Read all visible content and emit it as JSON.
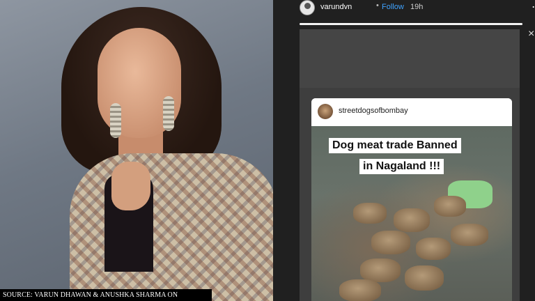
{
  "left_panel": {
    "caption": "SOURCE: VARUN DHAWAN & ANUSHKA SHARMA ON INSTAGRAM"
  },
  "story": {
    "username": "varundvn",
    "separator": "•",
    "follow_label": "Follow",
    "time": "19h",
    "more_icon": "⋯",
    "close_icon": "×",
    "progress": 1.0,
    "shared_post": {
      "username": "streetdogsofbombay",
      "overlay_line_1": "Dog meat trade Banned",
      "overlay_line_2": "in Nagaland !!!"
    }
  }
}
